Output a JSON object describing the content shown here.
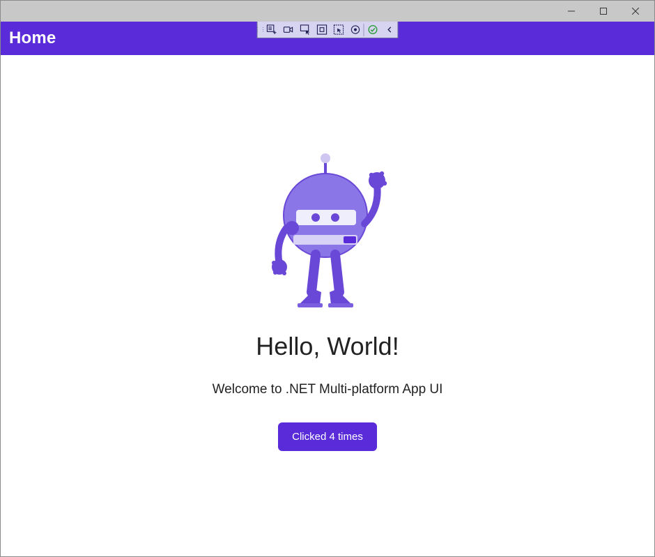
{
  "window": {
    "title": ""
  },
  "header": {
    "title": "Home"
  },
  "debug_toolbar": {
    "icons": [
      "live-visual-tree-icon",
      "record-icon",
      "select-element-icon",
      "display-layout-adorner-icon",
      "track-focus-icon",
      "hot-reload-settings-icon",
      "hot-reload-ok-icon",
      "collapse-toolbar-icon"
    ]
  },
  "main": {
    "bot_image_alt": "dotnet-bot-illustration",
    "headline": "Hello, World!",
    "subhead": "Welcome to .NET Multi-platform App UI",
    "counter_button_label": "Clicked 4 times"
  },
  "colors": {
    "accent": "#5a2bd9",
    "titlebar": "#c8c8c8",
    "debug_bg": "#d6d4f0"
  }
}
